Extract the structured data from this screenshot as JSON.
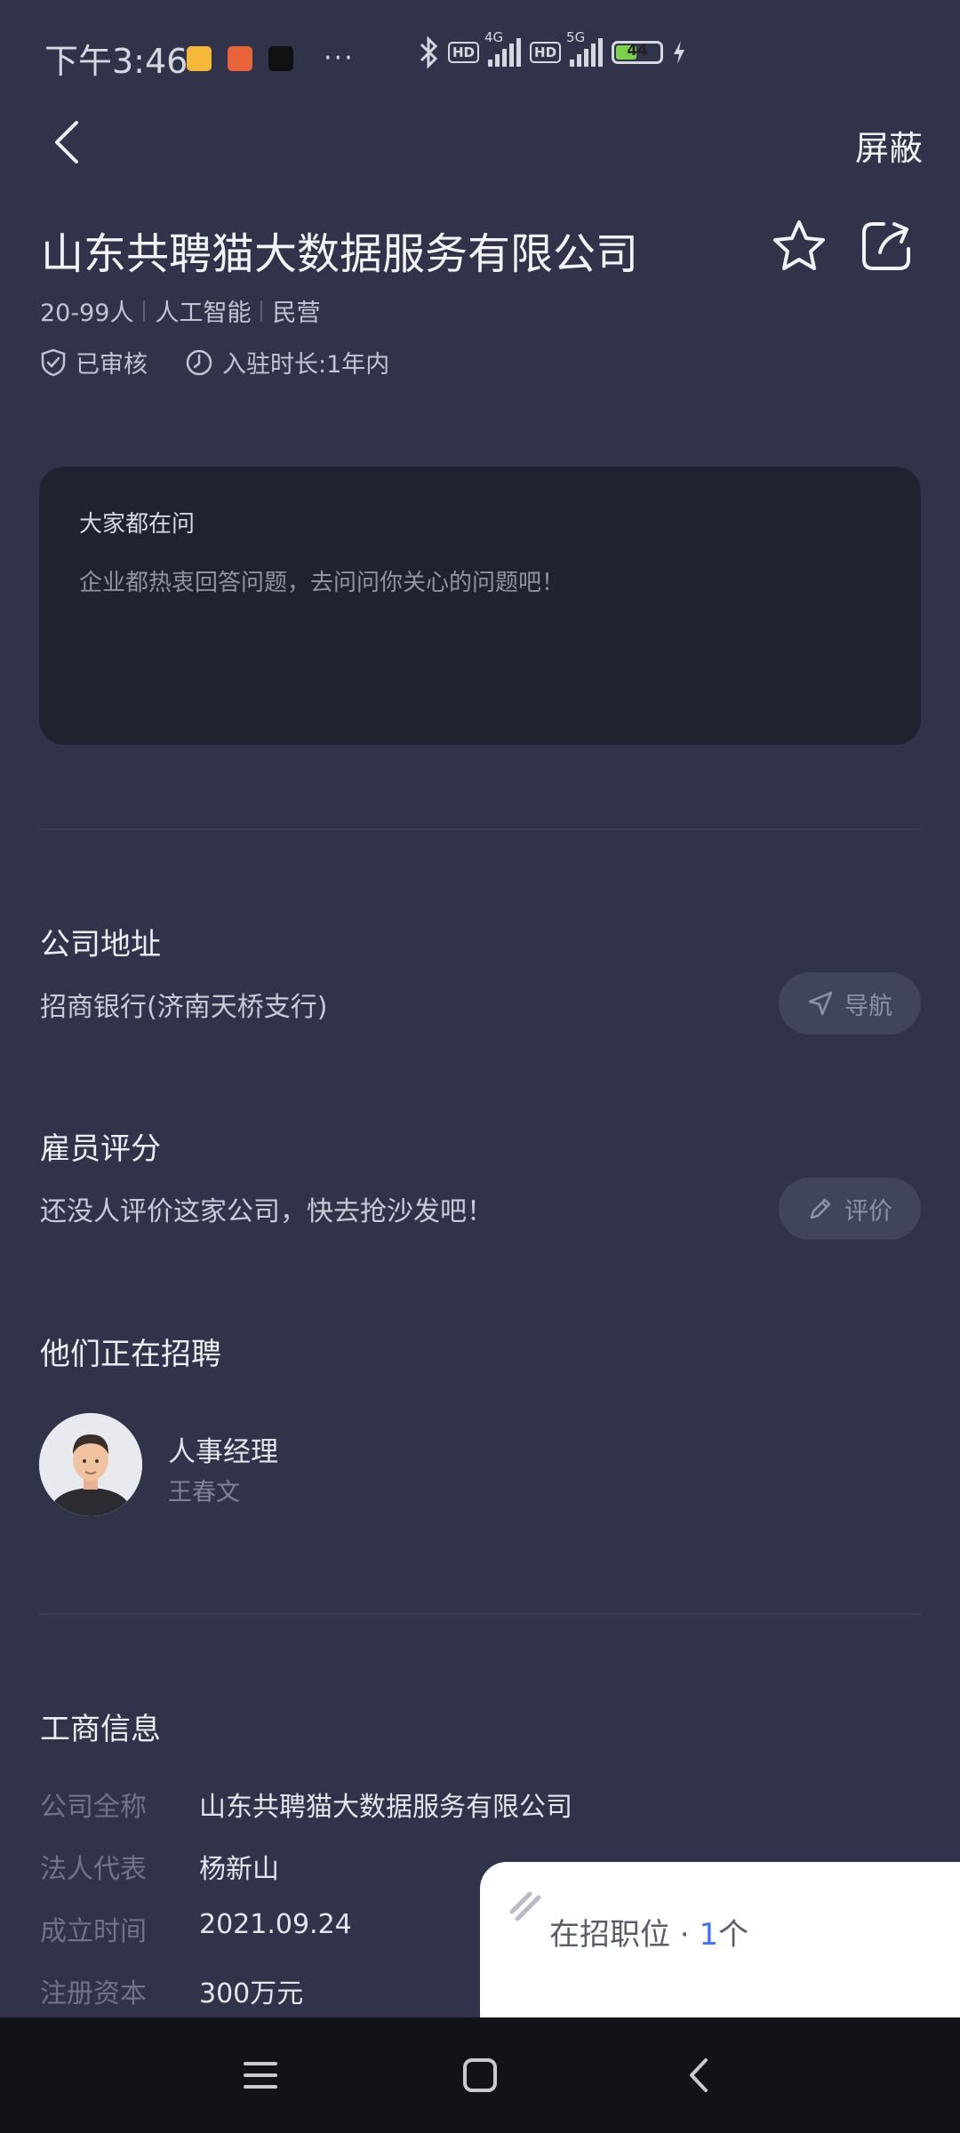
{
  "status_bar": {
    "time": "下午3:46",
    "network_1": "4G",
    "network_2": "5G",
    "hd_label": "HD",
    "battery": "44"
  },
  "header": {
    "block_label": "屏蔽"
  },
  "company": {
    "name": "山东共聘猫大数据服务有限公司",
    "tags": [
      "20-99人",
      "人工智能",
      "民营"
    ],
    "verified_label": "已审核",
    "tenure_label": "入驻时长:1年内"
  },
  "ask": {
    "title": "大家都在问",
    "desc": "企业都热衷回答问题，去问问你关心的问题吧！"
  },
  "address": {
    "title": "公司地址",
    "value": "招商银行(济南天桥支行)",
    "nav_label": "导航"
  },
  "reviews": {
    "title": "雇员评分",
    "empty_text": "还没人评价这家公司，快去抢沙发吧！",
    "review_label": "评价"
  },
  "recruiters": {
    "title": "他们正在招聘",
    "items": [
      {
        "role": "人事经理",
        "name": "王春文"
      }
    ]
  },
  "business_info": {
    "title": "工商信息",
    "rows": [
      {
        "label": "公司全称",
        "value": "山东共聘猫大数据服务有限公司"
      },
      {
        "label": "法人代表",
        "value": "杨新山"
      },
      {
        "label": "成立时间",
        "value": "2021.09.24"
      },
      {
        "label": "注册资本",
        "value": "300万元"
      }
    ]
  },
  "jobs_panel": {
    "prefix": "在招职位 · ",
    "count": "1",
    "suffix": "个"
  },
  "icons": [
    "back-icon",
    "star-icon",
    "share-icon",
    "shield-check-icon",
    "clock-icon",
    "navigation-arrow-icon",
    "pencil-icon",
    "menu-icon",
    "home-square-icon",
    "back-triangle-icon"
  ],
  "colors": {
    "background": "#30334a",
    "card": "#202230",
    "accent": "#3e72ff",
    "pill": "#41455c"
  }
}
